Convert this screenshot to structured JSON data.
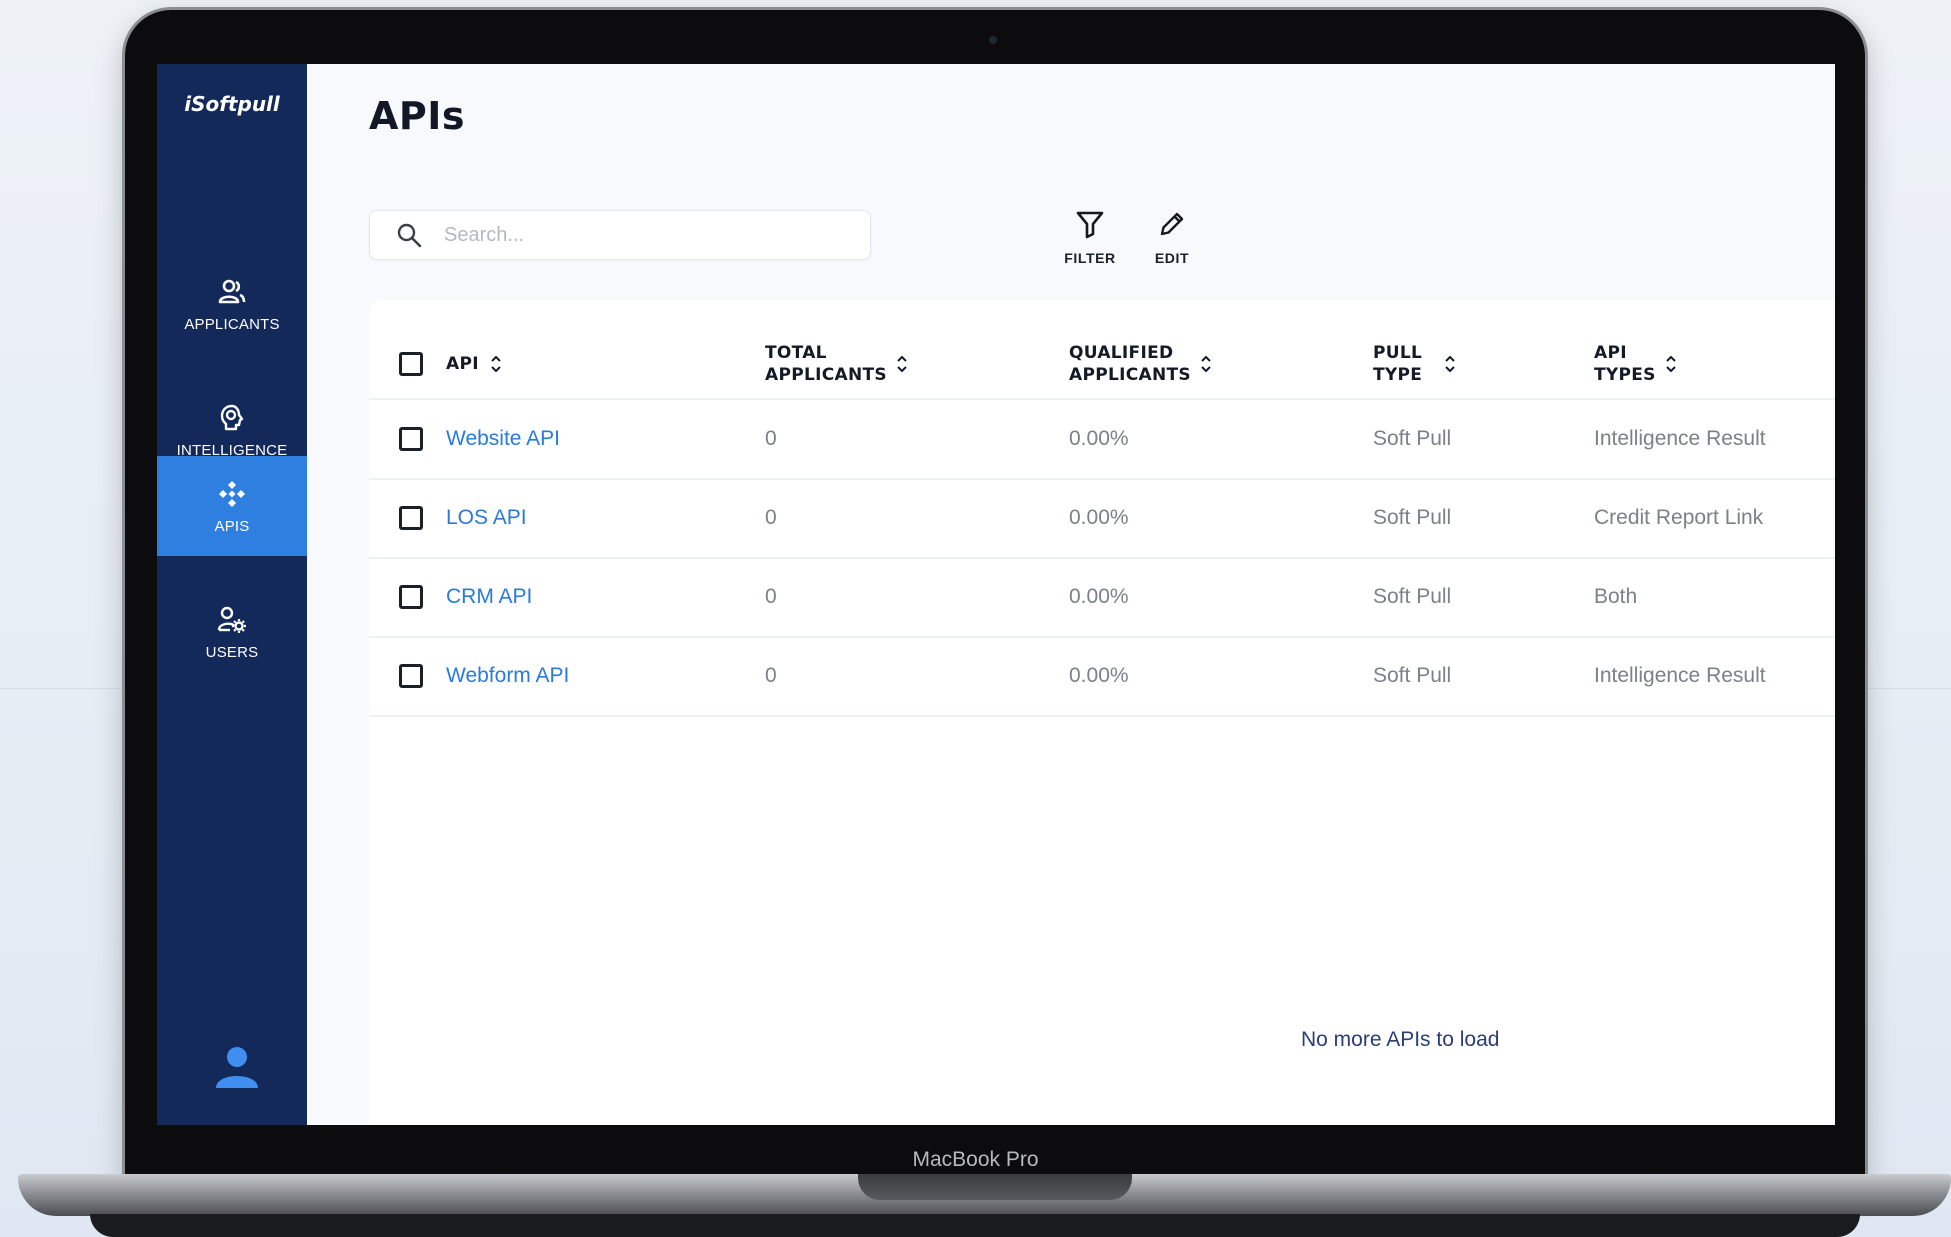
{
  "device": {
    "label": "MacBook Pro"
  },
  "app": {
    "logo": "iSoftpull"
  },
  "sidebar": {
    "items": [
      {
        "label": "APPLICANTS",
        "icon": "applicants-icon",
        "active": false
      },
      {
        "label": "INTELLIGENCE",
        "icon": "brain-icon",
        "active": false
      },
      {
        "label": "APIS",
        "icon": "api-icon",
        "active": true
      },
      {
        "label": "USERS",
        "icon": "users-settings-icon",
        "active": false
      }
    ],
    "profile_icon": "user-avatar-icon"
  },
  "page": {
    "title": "APIs"
  },
  "search": {
    "placeholder": "Search..."
  },
  "toolbar": {
    "filter_label": "FILTER",
    "edit_label": "EDIT"
  },
  "table": {
    "columns": [
      {
        "label": "API"
      },
      {
        "label": "TOTAL APPLICANTS"
      },
      {
        "label": "QUALIFIED APPLICANTS"
      },
      {
        "label": "PULL TYPE"
      },
      {
        "label": "API TYPES"
      }
    ],
    "rows": [
      {
        "api": "Website API",
        "total": "0",
        "qualified": "0.00%",
        "pull_type": "Soft Pull",
        "api_types": "Intelligence Result"
      },
      {
        "api": "LOS API",
        "total": "0",
        "qualified": "0.00%",
        "pull_type": "Soft Pull",
        "api_types": "Credit Report Link"
      },
      {
        "api": "CRM API",
        "total": "0",
        "qualified": "0.00%",
        "pull_type": "Soft Pull",
        "api_types": "Both"
      },
      {
        "api": "Webform API",
        "total": "0",
        "qualified": "0.00%",
        "pull_type": "Soft Pull",
        "api_types": "Intelligence Result"
      }
    ],
    "footer": "No more APIs to load"
  },
  "colors": {
    "sidebar_bg": "#12295a",
    "active_nav": "#2f7fe0",
    "link": "#2a7ad9",
    "footer_text": "#2a3d76"
  }
}
